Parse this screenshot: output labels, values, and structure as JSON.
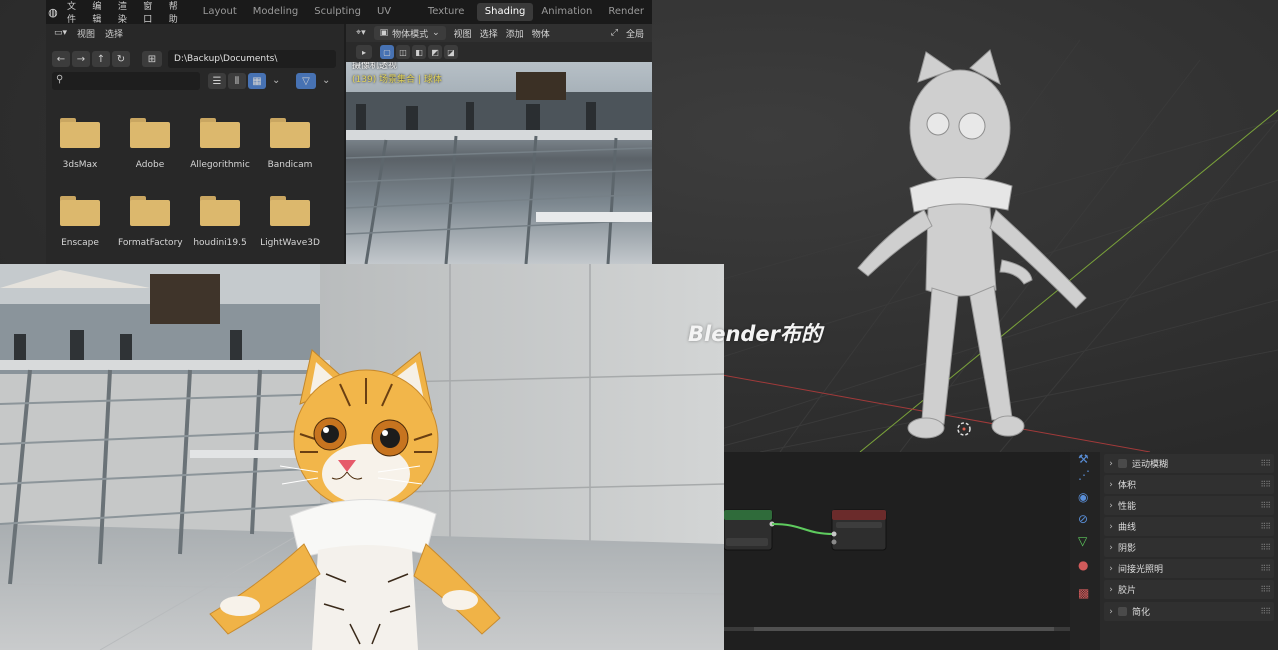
{
  "app": {
    "logo_icon": "blender-logo-icon"
  },
  "menubar": {
    "menus": [
      "文件",
      "编辑",
      "渲染",
      "窗口",
      "帮助"
    ],
    "workspace_tabs": [
      {
        "label": "Layout",
        "active": false
      },
      {
        "label": "Modeling",
        "active": false
      },
      {
        "label": "Sculpting",
        "active": false
      },
      {
        "label": "UV Editing",
        "active": false
      },
      {
        "label": "Texture Paint",
        "active": false
      },
      {
        "label": "Shading",
        "active": true
      },
      {
        "label": "Animation",
        "active": false
      },
      {
        "label": "Render",
        "active": false
      }
    ]
  },
  "file_browser": {
    "header_items": [
      "视图",
      "选择"
    ],
    "path": "D:\\Backup\\Documents\\",
    "search_placeholder": "",
    "folders": [
      "3dsMax",
      "Adobe",
      "Allegorithmic",
      "Bandicam",
      "Enscape",
      "FormatFactory",
      "houdini19.5",
      "LightWave3D"
    ],
    "folder_color": "#dcb86d"
  },
  "camera_view": {
    "header": {
      "mode": "物体模式",
      "items": [
        "视图",
        "选择",
        "添加",
        "物体"
      ],
      "global": "全局"
    },
    "overlay_title": "摄像机透视",
    "overlay_subtitle": "(139) 场景集合 | 球体"
  },
  "watermark": "Blender布的",
  "properties": {
    "sections": [
      {
        "label": "运动模糊",
        "checkbox": true
      },
      {
        "label": "体积",
        "checkbox": false
      },
      {
        "label": "性能",
        "checkbox": false
      },
      {
        "label": "曲线",
        "checkbox": false
      },
      {
        "label": "阴影",
        "checkbox": false
      },
      {
        "label": "间接光照明",
        "checkbox": false
      },
      {
        "label": "胶片",
        "checkbox": false
      },
      {
        "label": "简化",
        "checkbox": true
      }
    ],
    "tool_icons": [
      "wrench-icon",
      "particles-icon",
      "physics-icon",
      "constraint-icon",
      "object-data-icon",
      "material-icon",
      "texture-icon"
    ]
  },
  "colors": {
    "accent_blue": "#4772b3",
    "active_tab_bg": "#3a3a3a",
    "node_header_green": "#2f6b3a",
    "node_link_green": "#5ecb5e"
  }
}
